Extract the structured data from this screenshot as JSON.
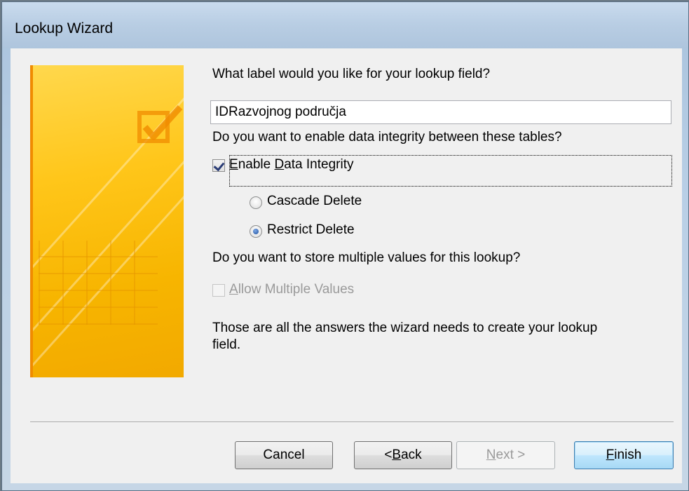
{
  "window": {
    "title": "Lookup Wizard"
  },
  "prompts": {
    "label_question": "What label would you like for your lookup field?",
    "integrity_question": "Do you want to enable data integrity between these tables?",
    "multi_question": "Do you want to store multiple values for this lookup?",
    "summary": "Those are all the answers the wizard needs to create your lookup",
    "summary_line2": "field."
  },
  "label_field": {
    "value": "IDRazvojnog područja"
  },
  "enable_integrity": {
    "prefix": "",
    "mnemonic": "E",
    "rest": "nable ",
    "mnemonic2": "D",
    "rest2": "ata Integrity",
    "checked": true
  },
  "cascade_delete": {
    "label": "Cascade Delete",
    "selected": false
  },
  "restrict_delete": {
    "label": "Restrict Delete",
    "selected": true
  },
  "allow_multiple": {
    "mnemonic": "A",
    "rest": "llow Multiple Values",
    "checked": false,
    "enabled": false
  },
  "buttons": {
    "cancel": "Cancel",
    "back_prefix": "< ",
    "back_mnemonic": "B",
    "back_rest": "ack",
    "next_mnemonic": "N",
    "next_rest": "ext >",
    "finish_mnemonic": "F",
    "finish_rest": "inish"
  },
  "colors": {
    "banner": "#ffc61a",
    "banner_edge": "#f08b00",
    "default_button": "#3c7fb1"
  },
  "icons": {
    "banner_icon": "checkmark-box-icon"
  }
}
